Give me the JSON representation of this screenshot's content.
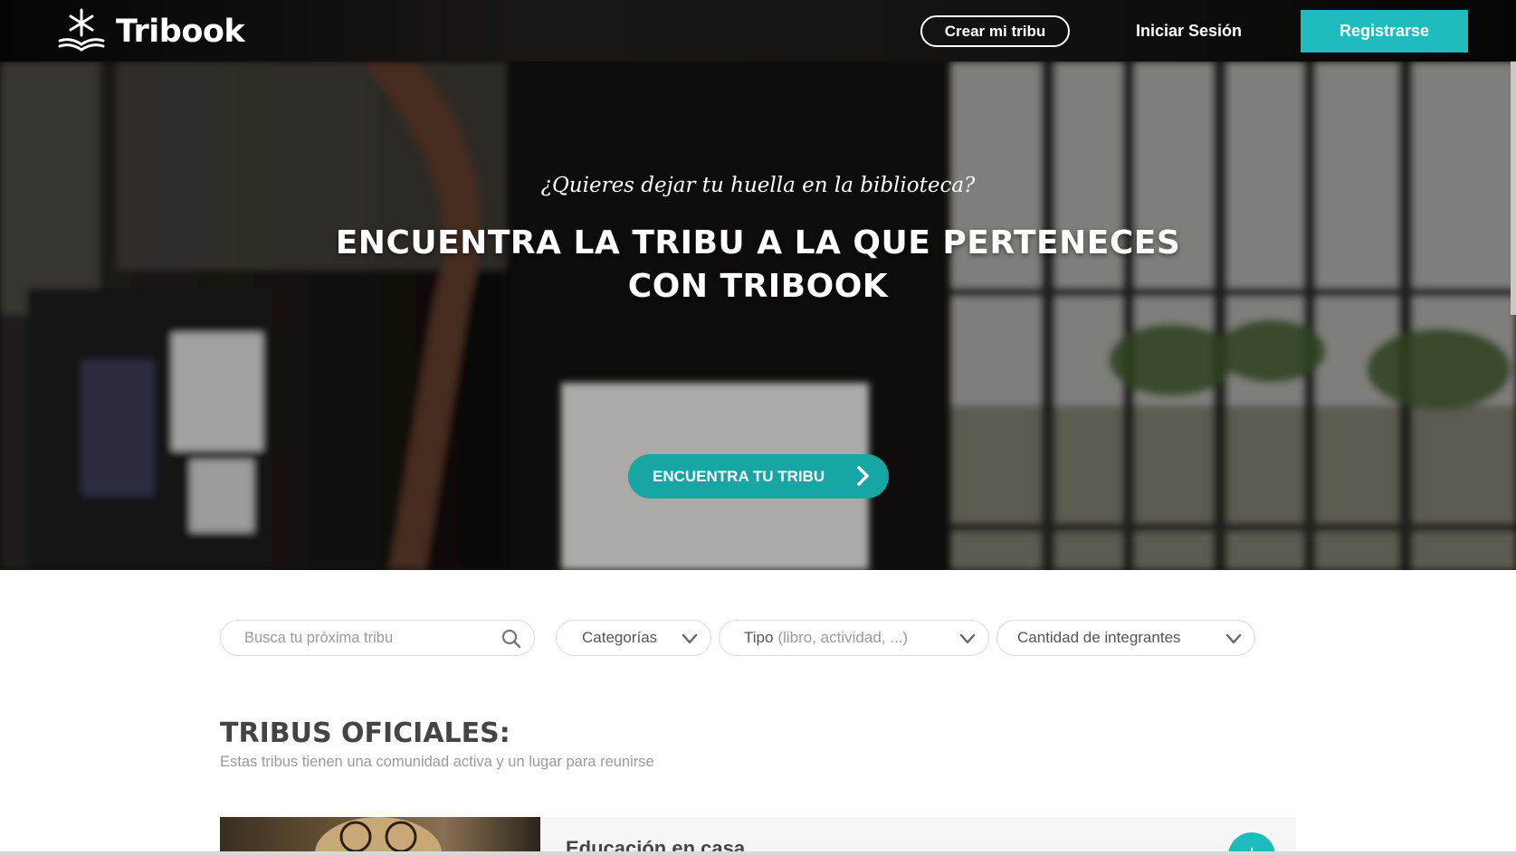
{
  "nav": {
    "brand_name": "Tribook",
    "create_button": "Crear mi tribu",
    "login_link": "Iniciar Sesión",
    "register_button": "Registrarse",
    "accent_color": "#1fbcbd"
  },
  "hero": {
    "question": "¿Quieres dejar tu huella en la biblioteca?",
    "title_line1": "ENCUENTRA LA TRIBU A LA QUE PERTENECES",
    "title_line2": "CON TRIBOOK",
    "cta_label": "ENCUENTRA TU TRIBU"
  },
  "filters": {
    "search_placeholder": "Busca tu próxima tribu",
    "categories_label": "Categorías",
    "type_label": "Tipo",
    "type_hint": "(libro, actividad, ...)",
    "members_label": "Cantidad de integrantes"
  },
  "section": {
    "title": "TRIBUS OFICIALES:",
    "subtitle": "Estas tribus tienen una comunidad activa y un lugar para reunirse"
  },
  "card": {
    "title": "Educación en casa",
    "add_symbol": "+"
  }
}
